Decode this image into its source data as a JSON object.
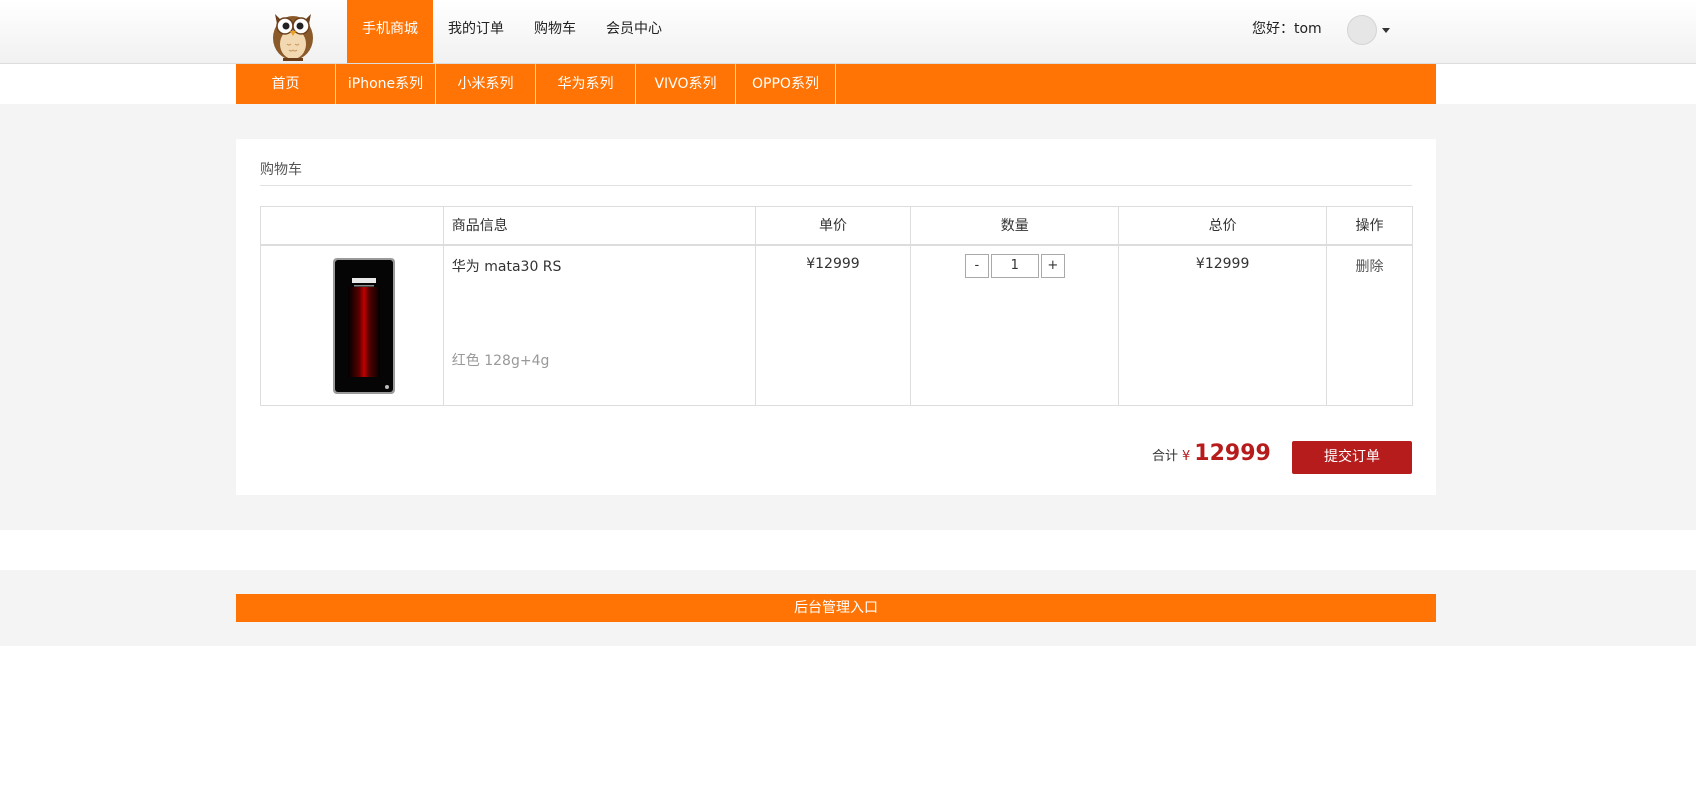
{
  "header": {
    "nav": [
      {
        "label": "手机商城",
        "active": true
      },
      {
        "label": "我的订单",
        "active": false
      },
      {
        "label": "购物车",
        "active": false
      },
      {
        "label": "会员中心",
        "active": false
      }
    ],
    "greeting": "您好：tom",
    "logo_icon": "owl-logo",
    "avatar_icon": "user-avatar-icon"
  },
  "categories": [
    "首页",
    "iPhone系列",
    "小米系列",
    "华为系列",
    "VIVO系列",
    "OPPO系列"
  ],
  "cart": {
    "title": "购物车",
    "columns": [
      "",
      "商品信息",
      "单价",
      "数量",
      "总价",
      "操作"
    ],
    "items": [
      {
        "name": "华为 mata30 RS",
        "spec": "红色 128g+4g",
        "unit_price": "¥12999",
        "quantity": "1",
        "total_price": "¥12999",
        "action": "删除"
      }
    ],
    "qty_minus": "-",
    "qty_plus": "+",
    "summary_label": "合计",
    "summary_currency": "¥",
    "summary_total": "12999",
    "submit_label": "提交订单"
  },
  "footer": {
    "admin_link": "后台管理入口"
  },
  "colors": {
    "accent": "#ff7405",
    "price": "#b71c1c",
    "submit": "#b71c1c"
  }
}
